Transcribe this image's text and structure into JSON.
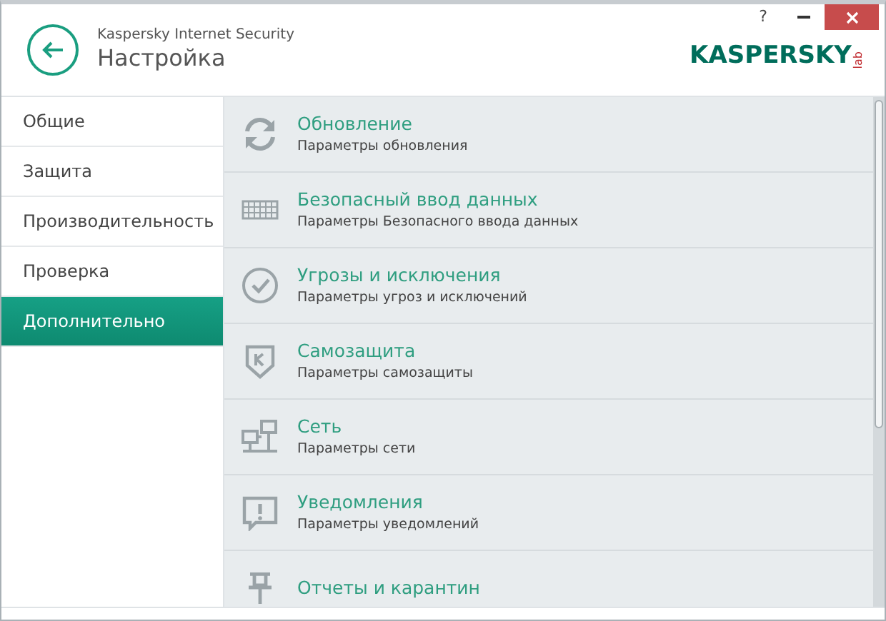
{
  "window": {
    "app_name": "Kaspersky Internet Security",
    "title": "Настройка",
    "help": "?",
    "logo": {
      "word": "KASPERSKY",
      "suffix": "lab"
    }
  },
  "sidebar": {
    "items": [
      {
        "label": "Общие",
        "selected": false
      },
      {
        "label": "Защита",
        "selected": false
      },
      {
        "label": "Производительность",
        "selected": false
      },
      {
        "label": "Проверка",
        "selected": false
      },
      {
        "label": "Дополнительно",
        "selected": true
      }
    ]
  },
  "settings": [
    {
      "kind": "update",
      "title": "Обновление",
      "subtitle": "Параметры обновления"
    },
    {
      "kind": "keyboard",
      "title": "Безопасный ввод данных",
      "subtitle": "Параметры Безопасного ввода данных"
    },
    {
      "kind": "threats",
      "title": "Угрозы и исключения",
      "subtitle": "Параметры угроз и исключений"
    },
    {
      "kind": "selfdefense",
      "title": "Самозащита",
      "subtitle": "Параметры самозащиты"
    },
    {
      "kind": "network",
      "title": "Сеть",
      "subtitle": "Параметры сети"
    },
    {
      "kind": "notifications",
      "title": "Уведомления",
      "subtitle": "Параметры уведомлений"
    },
    {
      "kind": "reports",
      "title": "Отчеты и карантин"
    }
  ]
}
